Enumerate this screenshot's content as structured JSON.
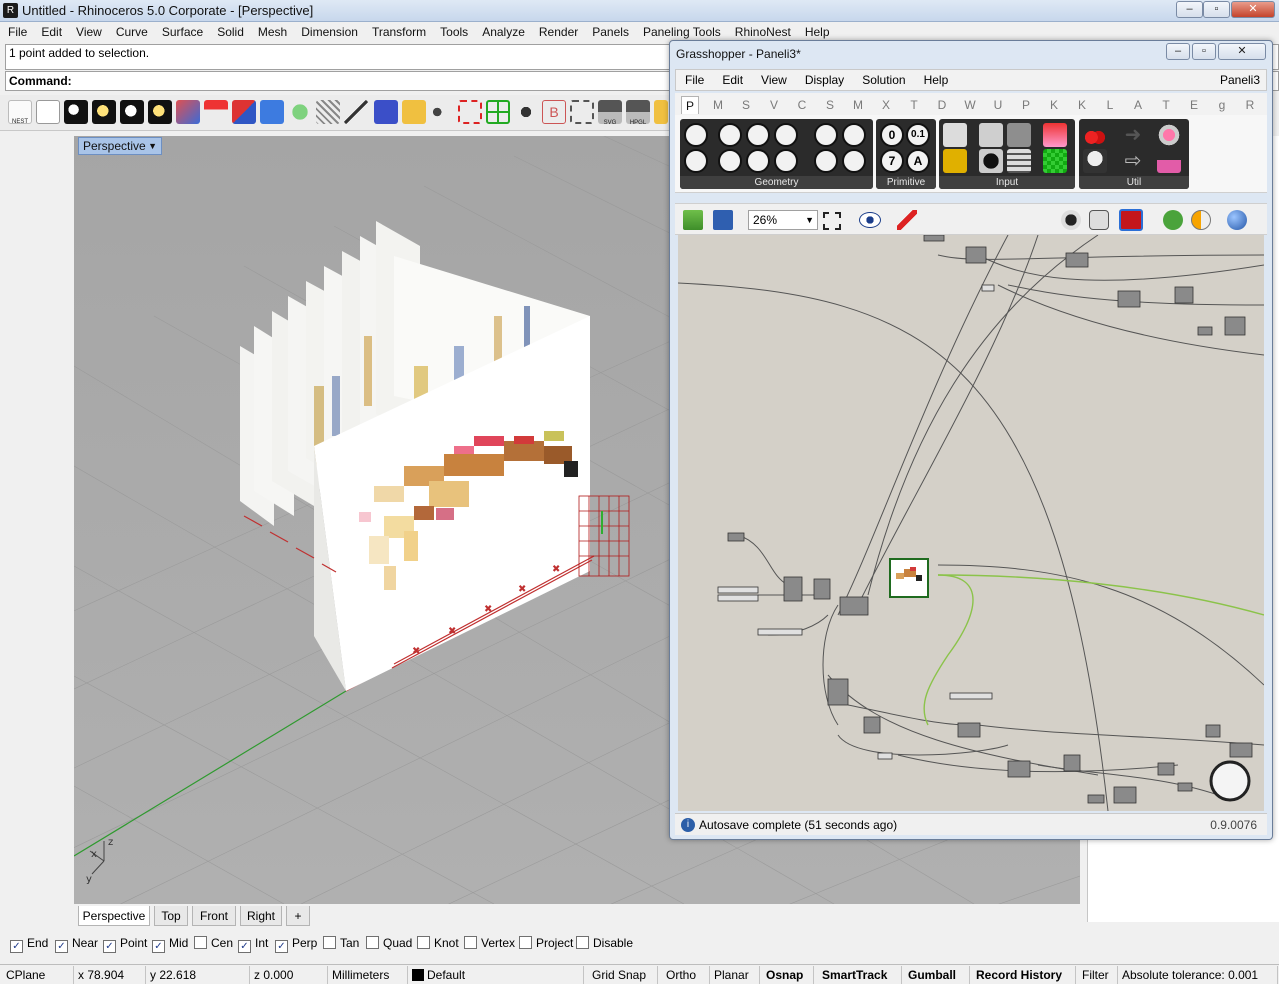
{
  "rhino": {
    "title": "Untitled - Rhinoceros  5.0 Corporate - [Perspective]",
    "menu": [
      "File",
      "Edit",
      "View",
      "Curve",
      "Surface",
      "Solid",
      "Mesh",
      "Dimension",
      "Transform",
      "Tools",
      "Analyze",
      "Render",
      "Panels",
      "Paneling Tools",
      "RhinoNest",
      "Help"
    ],
    "command_history": "1 point added to selection.",
    "command_prompt": "Command:",
    "toolbar_nest_label": "NEST",
    "toolbar_svg_label": "SVG",
    "toolbar_hpgl_label": "HPGL"
  },
  "viewport": {
    "label": "Perspective",
    "tabs": [
      "Perspective",
      "Top",
      "Front",
      "Right"
    ],
    "add_tab": "+",
    "axis_x": "x",
    "axis_y": "y",
    "axis_z": "z"
  },
  "osnap": [
    {
      "label": "End",
      "checked": true
    },
    {
      "label": "Near",
      "checked": true
    },
    {
      "label": "Point",
      "checked": true
    },
    {
      "label": "Mid",
      "checked": true
    },
    {
      "label": "Cen",
      "checked": false
    },
    {
      "label": "Int",
      "checked": true
    },
    {
      "label": "Perp",
      "checked": true
    },
    {
      "label": "Tan",
      "checked": false
    },
    {
      "label": "Quad",
      "checked": false
    },
    {
      "label": "Knot",
      "checked": false
    },
    {
      "label": "Vertex",
      "checked": false
    },
    {
      "label": "Project",
      "checked": false
    },
    {
      "label": "Disable",
      "checked": false
    }
  ],
  "status": {
    "cplane": "CPlane",
    "x": "x 78.904",
    "y": "y 22.618",
    "z": "z 0.000",
    "units": "Millimeters",
    "layer": "Default",
    "grid_snap": "Grid Snap",
    "ortho": "Ortho",
    "planar": "Planar",
    "osnap": "Osnap",
    "smarttrack": "SmartTrack",
    "gumball": "Gumball",
    "record_history": "Record History",
    "filter": "Filter",
    "tolerance": "Absolute tolerance: 0.001"
  },
  "grasshopper": {
    "title": "Grasshopper - Paneli3*",
    "menu": [
      "File",
      "Edit",
      "View",
      "Display",
      "Solution",
      "Help"
    ],
    "doc_name": "Paneli3",
    "tabs": [
      "P",
      "M",
      "S",
      "V",
      "C",
      "S",
      "M",
      "X",
      "T",
      "D",
      "W",
      "U",
      "P",
      "K",
      "K",
      "L",
      "A",
      "T",
      "E",
      "g",
      "R"
    ],
    "ribbon_groups": [
      "Geometry",
      "Primitive",
      "Input",
      "Util"
    ],
    "primitive_glyphs": [
      "0",
      "0.1",
      "7",
      "A"
    ],
    "zoom": "26%",
    "status_message": "Autosave complete (51 seconds ago)",
    "version": "0.9.0076"
  },
  "colors": {
    "viewport_bg": "#a8a8a8",
    "grid_line": "#9a9a9a",
    "x_axis": "#c03030",
    "y_axis": "#2f9a2f",
    "gh_canvas": "#d4d0c8",
    "gh_wire": "#555555",
    "gh_wire_selected": "#8bc34a"
  }
}
